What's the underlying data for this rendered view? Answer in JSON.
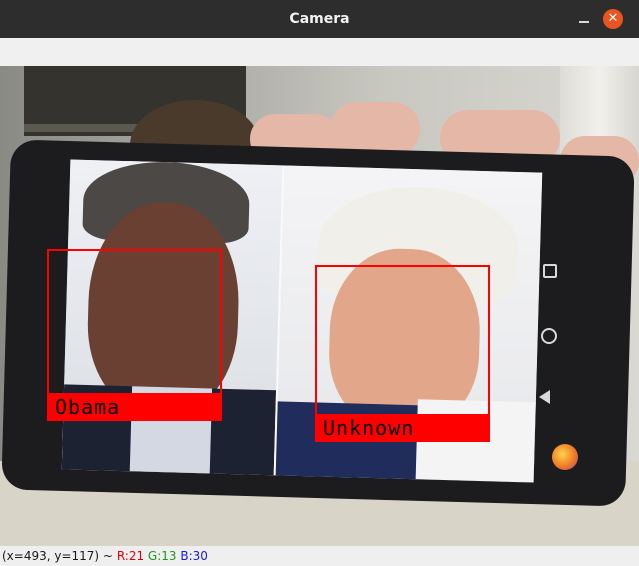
{
  "window": {
    "title": "Camera",
    "close_glyph": "✕"
  },
  "detections": [
    {
      "label": "Obama"
    },
    {
      "label": "Unknown"
    }
  ],
  "status": {
    "coords": "(x=493, y=117) ~",
    "r": "R:21",
    "g": "G:13",
    "b": "B:30"
  },
  "colors": {
    "detection_box": "#ff0000",
    "titlebar": "#2d2d2d",
    "close_button": "#e95420"
  },
  "icons": [
    "minimize-icon",
    "close-icon",
    "nav-recents-icon",
    "nav-home-icon",
    "nav-back-icon",
    "firefox-icon"
  ]
}
